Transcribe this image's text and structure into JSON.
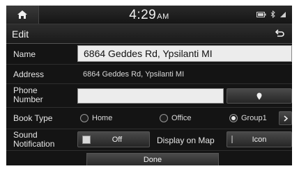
{
  "status": {
    "time": "4:29",
    "ampm": "AM"
  },
  "header": {
    "title": "Edit"
  },
  "form": {
    "name_label": "Name",
    "name_value": "6864 Geddes Rd, Ypsilanti MI",
    "address_label": "Address",
    "address_value": "6864 Geddes Rd, Ypsilanti MI",
    "phone_label_line1": "Phone",
    "phone_label_line2": "Number",
    "phone_value": "",
    "booktype_label": "Book Type",
    "booktype_options": [
      "Home",
      "Office",
      "Group1"
    ],
    "booktype_selected": "Group1",
    "sound_label_line1": "Sound",
    "sound_label_line2": "Notification",
    "sound_value": "Off",
    "display_label": "Display on Map",
    "display_value": "Icon"
  },
  "footer": {
    "done_label": "Done"
  },
  "icons": {
    "home": "home-icon",
    "back": "back-arrow-icon",
    "map_pin": "map-pin-icon",
    "chevron": "chevron-right-icon",
    "battery": "battery-icon",
    "bluetooth": "bluetooth-icon",
    "signal": "signal-icon"
  }
}
